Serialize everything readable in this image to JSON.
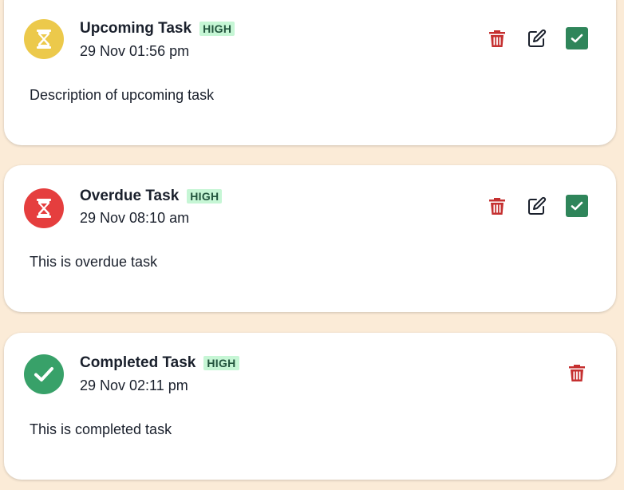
{
  "tasks": [
    {
      "title": "Upcoming Task",
      "priority": "HIGH",
      "date": "29 Nov 01:56 pm",
      "description": "Description of upcoming task",
      "status": "upcoming",
      "status_icon": "hourglass-icon",
      "status_color": "#ecc94b"
    },
    {
      "title": "Overdue Task",
      "priority": "HIGH",
      "date": "29 Nov 08:10 am",
      "description": "This is overdue task",
      "status": "overdue",
      "status_icon": "hourglass-icon",
      "status_color": "#e53e3e"
    },
    {
      "title": "Completed Task",
      "priority": "HIGH",
      "date": "29 Nov 02:11 pm",
      "description": "This is completed task",
      "status": "completed",
      "status_icon": "check-icon",
      "status_color": "#38a169"
    }
  ],
  "colors": {
    "page_background": "#fbebd7",
    "delete": "#c53030",
    "complete_button": "#2f855a",
    "badge_background": "#c6f6d5",
    "badge_text": "#22543d"
  },
  "icons": {
    "delete": "trash-icon",
    "edit": "edit-icon",
    "complete": "check-icon"
  }
}
